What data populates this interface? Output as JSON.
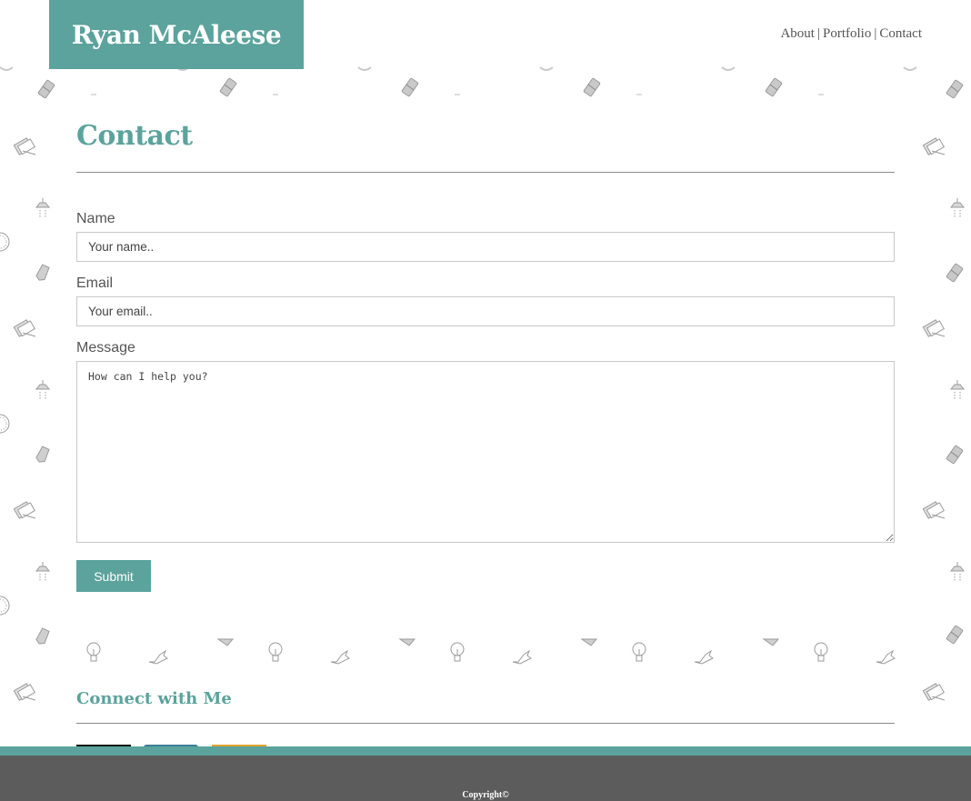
{
  "header": {
    "logo_text": "Ryan McAleese",
    "nav": [
      {
        "label": "About"
      },
      {
        "label": "Portfolio"
      },
      {
        "label": "Contact"
      }
    ],
    "nav_separator": "|"
  },
  "main": {
    "title": "Contact",
    "form": {
      "name_label": "Name",
      "name_placeholder": "Your name..",
      "email_label": "Email",
      "email_placeholder": "Your email..",
      "message_label": "Message",
      "message_placeholder": "How can I help you?",
      "submit_label": "Submit"
    },
    "connect_title": "Connect with Me"
  },
  "footer": {
    "copyright": "Copyright©"
  },
  "colors": {
    "accent": "#5ba39c",
    "footer_bg": "#5c5c5c",
    "text": "#5c5c5c",
    "social_1": "#111111",
    "social_2": "#3d7f96",
    "social_3": "#e0a52f"
  },
  "icons": [
    "eraser-icon",
    "pencil-icon",
    "lamp-icon",
    "compass-icon",
    "bulb-icon",
    "hand-icon",
    "paper-stack-icon"
  ]
}
